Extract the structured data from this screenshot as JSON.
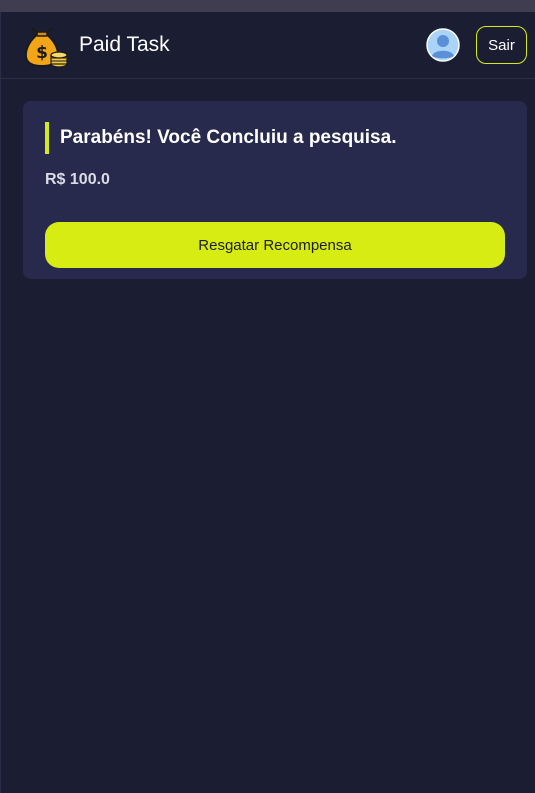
{
  "header": {
    "app_name": "Paid Task",
    "logo_icon": "money-bag-icon",
    "avatar_icon": "user-avatar-icon",
    "logout_label": "Sair"
  },
  "card": {
    "title": "Parabéns! Você Concluiu a pesquisa.",
    "amount": "R$ 100.0",
    "button_label": "Resgatar Recompensa"
  },
  "colors": {
    "background": "#1b1d33",
    "card": "#282a4d",
    "accent": "#d6ec13"
  }
}
